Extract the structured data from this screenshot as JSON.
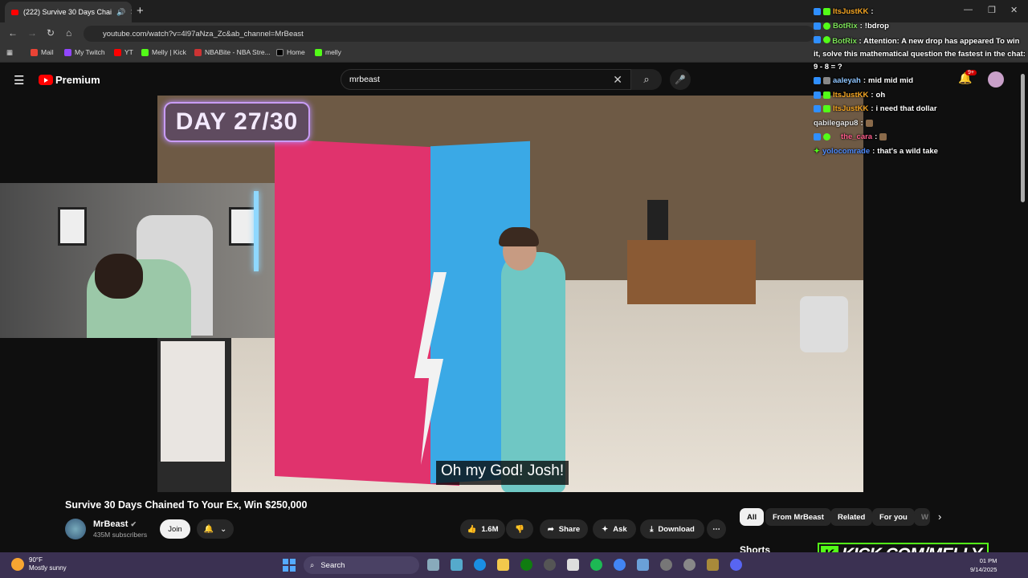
{
  "browser": {
    "tab_title": "(222) Survive 30 Days Chai",
    "url": "youtube.com/watch?v=4l97aNza_Zc&ab_channel=MrBeast",
    "bookmarks": [
      "Mail",
      "My Twitch",
      "YT",
      "Melly | Kick",
      "NBABite - NBA Stre...",
      "Home",
      "melly"
    ]
  },
  "youtube": {
    "logo_text": "Premium",
    "search_value": "mrbeast",
    "notif_count": "9+",
    "video": {
      "badge": "DAY 27/30",
      "subtitle": "Oh my God! Josh!"
    },
    "title": "Survive 30 Days Chained To Your Ex, Win $250,000",
    "channel": "MrBeast",
    "subscribers": "435M subscribers",
    "join_label": "Join",
    "likes": "1.6M",
    "share_label": "Share",
    "ask_label": "Ask",
    "download_label": "Download",
    "chips": [
      "All",
      "From MrBeast",
      "Related",
      "For you",
      "W"
    ],
    "shorts_label": "Shorts"
  },
  "chat": [
    {
      "user": "ItsJustKK",
      "msg": "",
      "color": "#f5a623"
    },
    {
      "user": "BotRix",
      "msg": "!bdrop",
      "color": "#7ee35a"
    },
    {
      "user": "BotRix",
      "msg": "Attention: A new drop has appeared To win it, solve this mathematical question the fastest in the chat: 9 - 8 = ?",
      "color": "#7ee35a"
    },
    {
      "user": "aaleyah",
      "msg": "mid mid mid",
      "color": "#8ec5ff"
    },
    {
      "user": "ItsJustKK",
      "msg": "oh",
      "color": "#f5a623"
    },
    {
      "user": "ItsJustKK",
      "msg": "i need that dollar",
      "color": "#f5a623"
    },
    {
      "user": "qabilegapu8",
      "msg": "",
      "color": "#e6e6e6"
    },
    {
      "user": "the_cara",
      "msg": "",
      "color": "#ff5c8a"
    },
    {
      "user": "yolocomrade",
      "msg": "that's a wild take",
      "color": "#4f8cff"
    }
  ],
  "overlay": {
    "kick_text": "KICK.COM/MELLY"
  },
  "taskbar": {
    "temp": "90°F",
    "weather": "Mostly sunny",
    "search_label": "Search",
    "time": "01 PM",
    "date": "9/14/2025"
  }
}
